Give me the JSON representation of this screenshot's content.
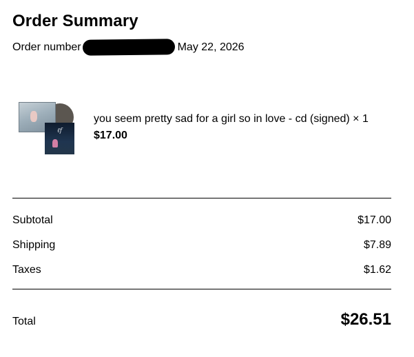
{
  "summary": {
    "title": "Order Summary",
    "order_label": "Order number",
    "date": "May 22, 2026"
  },
  "item": {
    "name": "you seem pretty sad for a girl so in love - cd (signed) × 1",
    "price": "$17.00",
    "thumbnail_signature": "ℓf"
  },
  "totals": {
    "subtotal_label": "Subtotal",
    "subtotal_value": "$17.00",
    "shipping_label": "Shipping",
    "shipping_value": "$7.89",
    "taxes_label": "Taxes",
    "taxes_value": "$1.62",
    "total_label": "Total",
    "total_value": "$26.51"
  }
}
